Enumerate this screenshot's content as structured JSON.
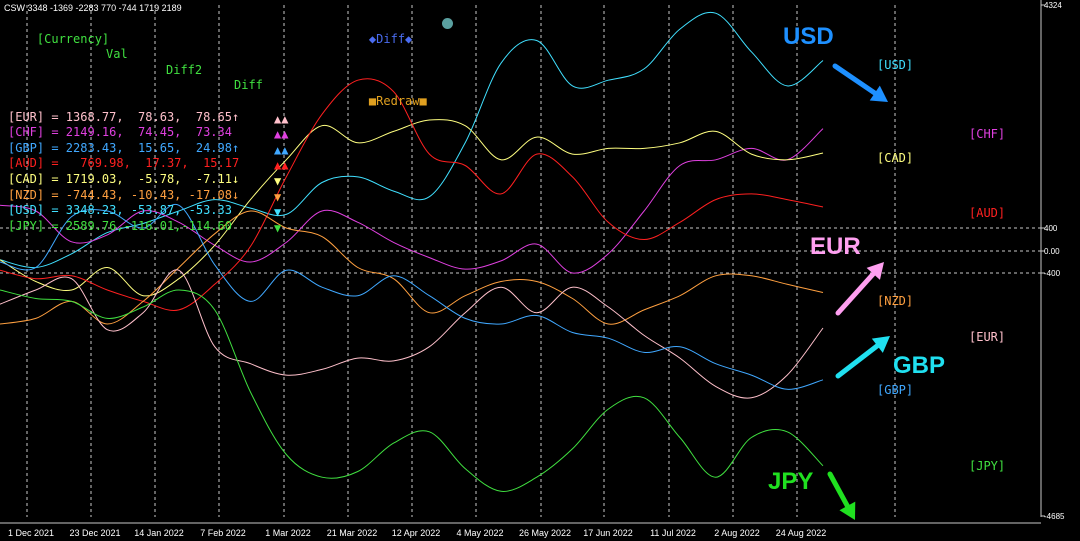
{
  "header": {
    "title": "CSW 3348 -1369 -2283 770 -744 1719 2189"
  },
  "legend_panel": {
    "header": {
      "currency": "[Currency]",
      "val": "Val",
      "diff2": "Diff2",
      "diff": "Diff"
    },
    "rows": [
      {
        "text": "[EUR] = 1368.77,  78.63,  78.65",
        "arrow": "↑",
        "color": "#ffc0cb",
        "tri": "up"
      },
      {
        "text": "[CHF] = 2149.16,  74.45,  73.34",
        "arrow": "",
        "color": "#e040e0",
        "tri": "up"
      },
      {
        "text": "[GBP] = 2283.43,  15.65,  24.98",
        "arrow": "↑",
        "color": "#40a8ff",
        "tri": "up"
      },
      {
        "text": "[AUD] =   769.98,  17.37,  15.17",
        "arrow": "",
        "color": "#ff2020",
        "tri": "up"
      },
      {
        "text": "[CAD] = 1719.03,  -5.78,  -7.11",
        "arrow": "↓",
        "color": "#ffff80",
        "tri": "down"
      },
      {
        "text": "[NZD] = -744.43, -10.43, -17.08",
        "arrow": "↓",
        "color": "#ffa040",
        "tri": "down"
      },
      {
        "text": "[USD] = 3348.23, -53.87, -53.33",
        "arrow": "",
        "color": "#40e0ff",
        "tri": "down"
      },
      {
        "text": "[JPY] = 2589.76,-116.01,-114.60",
        "arrow": "",
        "color": "#40e040",
        "tri": "down"
      }
    ],
    "buttons": {
      "diff_label": "Diff",
      "redraw_label": "Redraw"
    }
  },
  "right_labels": [
    {
      "text": "[USD]",
      "color": "#40e0ff"
    },
    {
      "text": "[CHF]",
      "color": "#e040e0"
    },
    {
      "text": "[CAD]",
      "color": "#ffff80"
    },
    {
      "text": "[AUD]",
      "color": "#ff2020"
    },
    {
      "text": "[NZD]",
      "color": "#ffa040"
    },
    {
      "text": "[EUR]",
      "color": "#ffc0cb"
    },
    {
      "text": "[GBP]",
      "color": "#40a8ff"
    },
    {
      "text": "[JPY]",
      "color": "#40e040"
    }
  ],
  "annotations": [
    {
      "text": "USD",
      "color": "#1e90ff",
      "arrow_dir": "down-right"
    },
    {
      "text": "EUR",
      "color": "#ff9ff0",
      "arrow_dir": "up-right"
    },
    {
      "text": "GBP",
      "color": "#20e0f0",
      "arrow_dir": "up-right"
    },
    {
      "text": "JPY",
      "color": "#20e020",
      "arrow_dir": "down-right"
    }
  ],
  "chart_data": {
    "type": "line",
    "title": "CSW 3348 -1369 -2283 770 -744 1719 2189",
    "ylim": [
      -4685,
      4324
    ],
    "y_ticks": [
      "4324",
      "400",
      "0.00",
      "-400",
      "-4685"
    ],
    "y_tick_values": [
      4324,
      400,
      0,
      -400,
      -4685
    ],
    "hlines": [
      400,
      0,
      -400
    ],
    "x_ticks": [
      "1 Dec 2021",
      "23 Dec 2021",
      "14 Jan 2022",
      "7 Feb 2022",
      "1 Mar 2022",
      "21 Mar 2022",
      "12 Apr 2022",
      "4 May 2022",
      "26 May 2022",
      "17 Jun 2022",
      "11 Jul 2022",
      "2 Aug 2022",
      "24 Aug 2022"
    ],
    "grid": "vertical dashed at x ticks",
    "series": [
      {
        "name": "USD",
        "color": "#40e0ff",
        "values": [
          -160,
          -300,
          -50,
          320,
          480,
          700,
          900,
          750,
          640,
          1200,
          1300,
          1050,
          950,
          1900,
          3300,
          3700,
          2900,
          3000,
          3200,
          3900,
          4180,
          3500,
          2900,
          3348
        ]
      },
      {
        "name": "CHF",
        "color": "#e040e0",
        "values": [
          800,
          700,
          160,
          280,
          700,
          500,
          100,
          -200,
          150,
          700,
          500,
          150,
          -120,
          -330,
          -180,
          120,
          -400,
          -50,
          700,
          1500,
          1600,
          1800,
          1600,
          2149
        ]
      },
      {
        "name": "CAD",
        "color": "#ffff80",
        "values": [
          -160,
          -550,
          -700,
          -300,
          -800,
          -500,
          100,
          900,
          1600,
          2200,
          1900,
          2100,
          2300,
          2200,
          1600,
          2000,
          1700,
          1800,
          1800,
          1900,
          2100,
          1700,
          1600,
          1719
        ]
      },
      {
        "name": "AUD",
        "color": "#ff2020",
        "values": [
          -350,
          -500,
          -450,
          -700,
          -900,
          -1050,
          -600,
          80,
          1300,
          2400,
          3000,
          2800,
          1700,
          1500,
          1000,
          1700,
          1300,
          500,
          200,
          500,
          900,
          1000,
          900,
          770
        ]
      },
      {
        "name": "NZD",
        "color": "#ffa040",
        "values": [
          -1300,
          -1200,
          -900,
          -1300,
          -900,
          -300,
          300,
          700,
          400,
          250,
          -300,
          -500,
          -1100,
          -800,
          -550,
          -550,
          -850,
          -1300,
          -1050,
          -800,
          -450,
          -450,
          -600,
          -744
        ]
      },
      {
        "name": "EUR",
        "color": "#ffc0cb",
        "values": [
          -950,
          -700,
          -500,
          -1400,
          -1100,
          -350,
          -1700,
          -2000,
          -2200,
          -2100,
          -1900,
          -1950,
          -1700,
          -1100,
          -650,
          -1100,
          -650,
          -1000,
          -1500,
          -1900,
          -2400,
          -2600,
          -2200,
          -1369
        ]
      },
      {
        "name": "GBP",
        "color": "#40a8ff",
        "values": [
          -200,
          -300,
          600,
          700,
          400,
          800,
          -250,
          -900,
          -350,
          -650,
          -800,
          -450,
          -800,
          -1200,
          -1300,
          -1150,
          -1450,
          -1550,
          -1800,
          -1700,
          -2000,
          -2200,
          -2450,
          -2283
        ]
      },
      {
        "name": "JPY",
        "color": "#40e040",
        "values": [
          -700,
          -850,
          -900,
          -1200,
          -1000,
          -700,
          -1050,
          -2500,
          -3600,
          -4000,
          -3900,
          -3400,
          -3200,
          -3850,
          -4250,
          -4000,
          -3500,
          -2800,
          -2600,
          -3300,
          -4000,
          -3300,
          -3200,
          -3800
        ]
      }
    ]
  }
}
